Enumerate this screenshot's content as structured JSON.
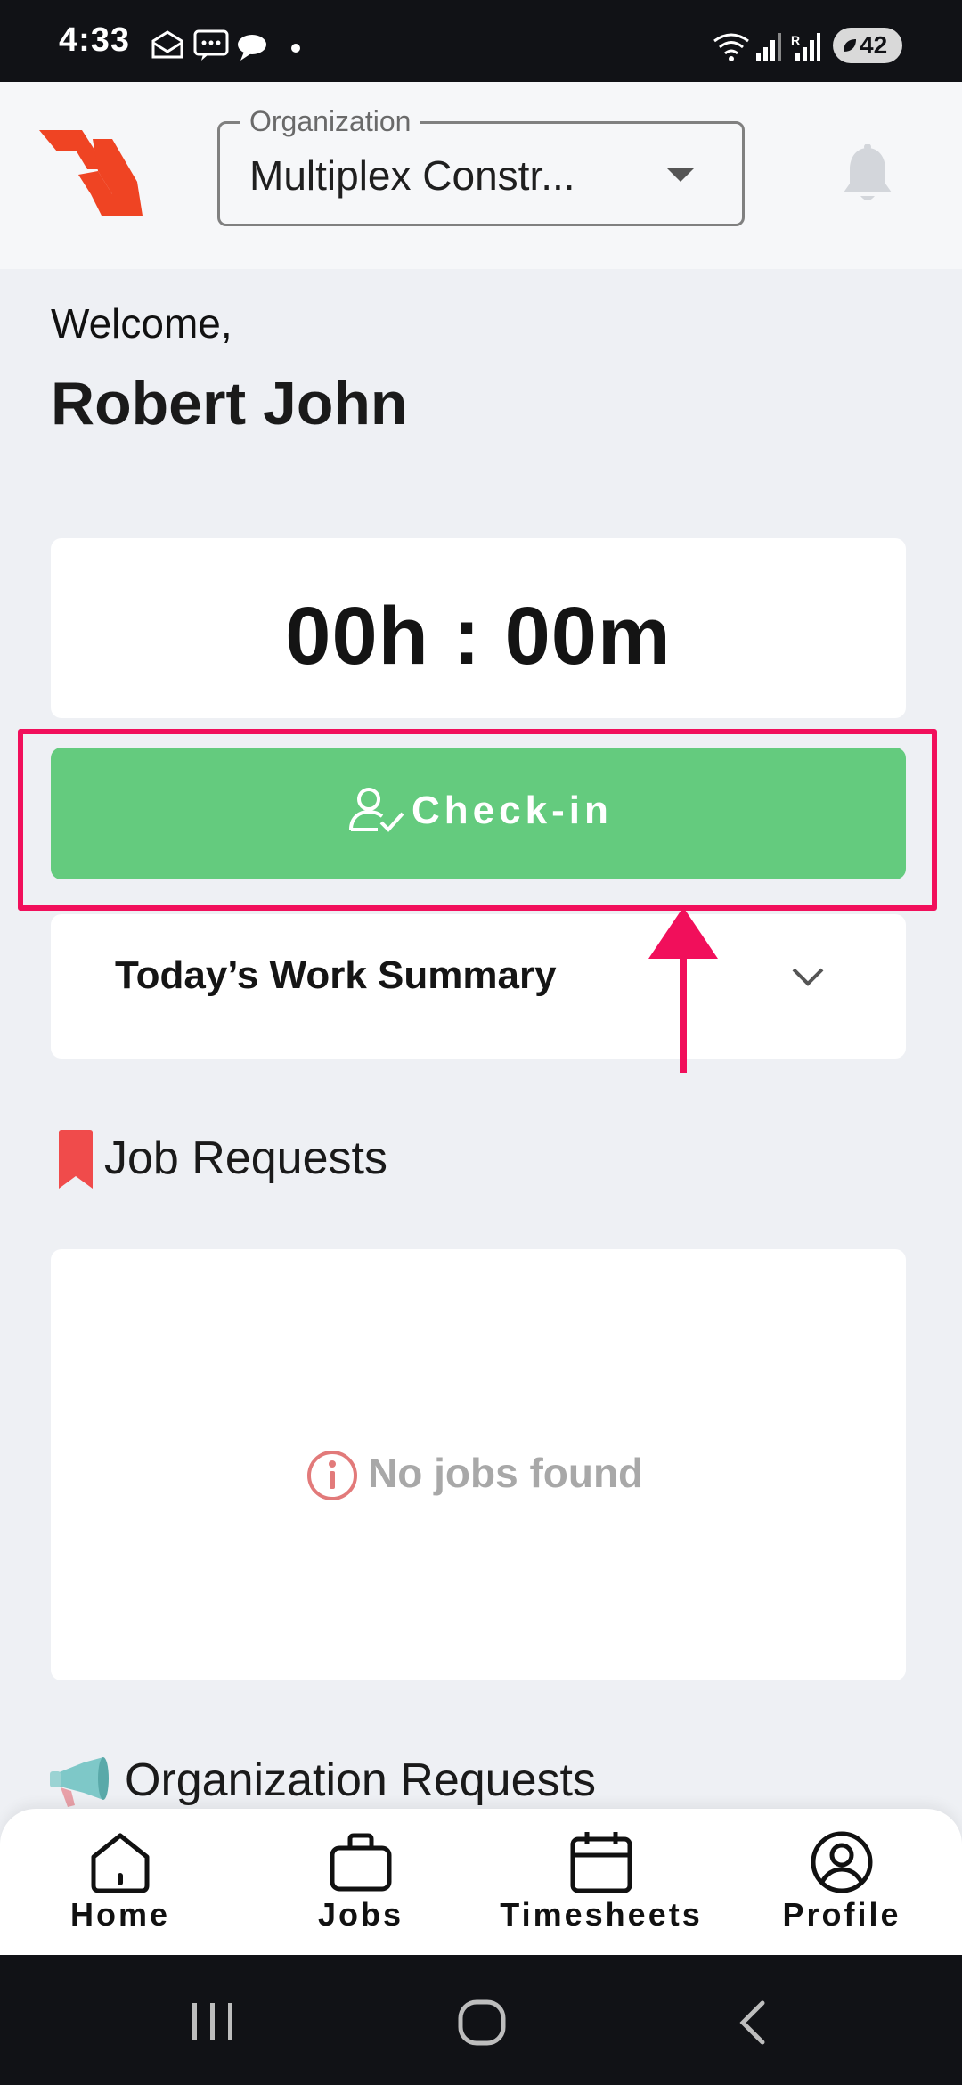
{
  "status_bar": {
    "time": "4:33",
    "battery": "42"
  },
  "header": {
    "organization_label": "Organization",
    "organization_value": "Multiplex Constr..."
  },
  "welcome": {
    "greeting": "Welcome,",
    "user_name": "Robert John"
  },
  "timer": {
    "value": "00h : 00m"
  },
  "checkin": {
    "label": "Check-in"
  },
  "work_summary": {
    "title": "Today’s Work Summary"
  },
  "job_requests": {
    "title": "Job Requests",
    "empty_message": "No jobs found"
  },
  "organization_requests": {
    "title": "Organization Requests"
  },
  "bottom_nav": {
    "items": [
      {
        "label": "Home",
        "icon": "home-icon"
      },
      {
        "label": "Jobs",
        "icon": "briefcase-icon"
      },
      {
        "label": "Timesheets",
        "icon": "calendar-icon"
      },
      {
        "label": "Profile",
        "icon": "profile-icon"
      }
    ]
  },
  "colors": {
    "brand_logo": "#ef4423",
    "checkin_green": "#64cb7e",
    "annotation_pink": "#f10f5b",
    "bookmark_red": "#f04b4b"
  }
}
